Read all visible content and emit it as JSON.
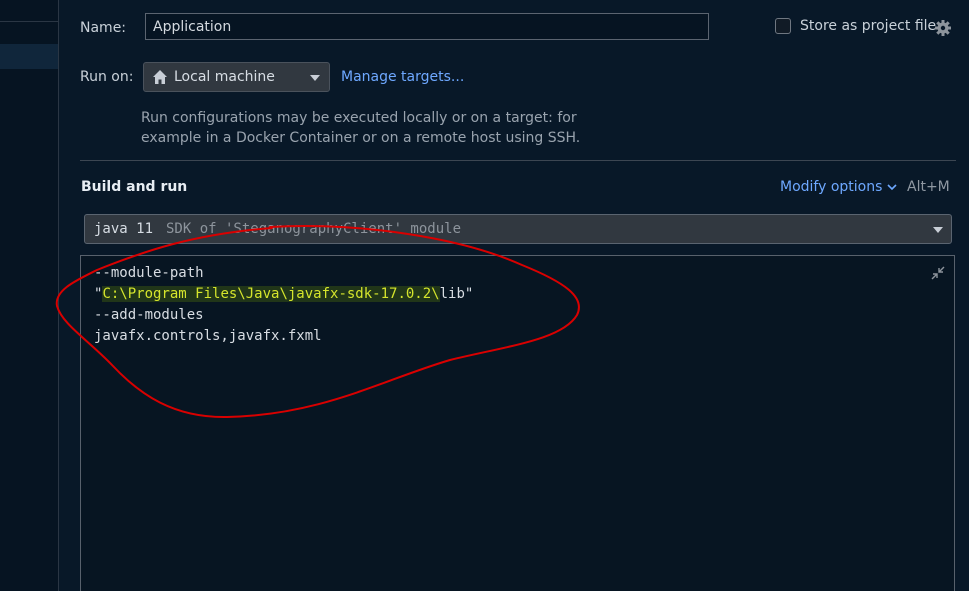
{
  "name_field": {
    "label": "Name:",
    "value": "Application"
  },
  "store": {
    "label": "Store as project file",
    "checked": false,
    "icon": "gear-icon"
  },
  "run_on": {
    "label": "Run on:",
    "selected": "Local machine",
    "icon": "home-icon",
    "manage_link": "Manage targets...",
    "help_line1": "Run configurations may be executed locally or on a target: for",
    "help_line2": "example in a Docker Container or on a remote host using SSH."
  },
  "build_run": {
    "title": "Build and run",
    "modify_options": "Modify options",
    "shortcut": "Alt+M",
    "sdk_java": "java 11",
    "sdk_desc": "SDK of 'SteganographyClient' module"
  },
  "vm_options": {
    "line1": "--module-path",
    "line2_quote_open": "\"",
    "line2_path": "C:\\Program Files\\Java\\javafx-sdk-17.0.2\\",
    "line2_rest": "lib\"",
    "line3": "--add-modules",
    "line4": "javafx.controls,javafx.fxml"
  },
  "colors": {
    "background": "#081828",
    "link": "#6ea8ff",
    "highlight_text": "#d5e52c",
    "annotation_stroke": "#d90000"
  }
}
